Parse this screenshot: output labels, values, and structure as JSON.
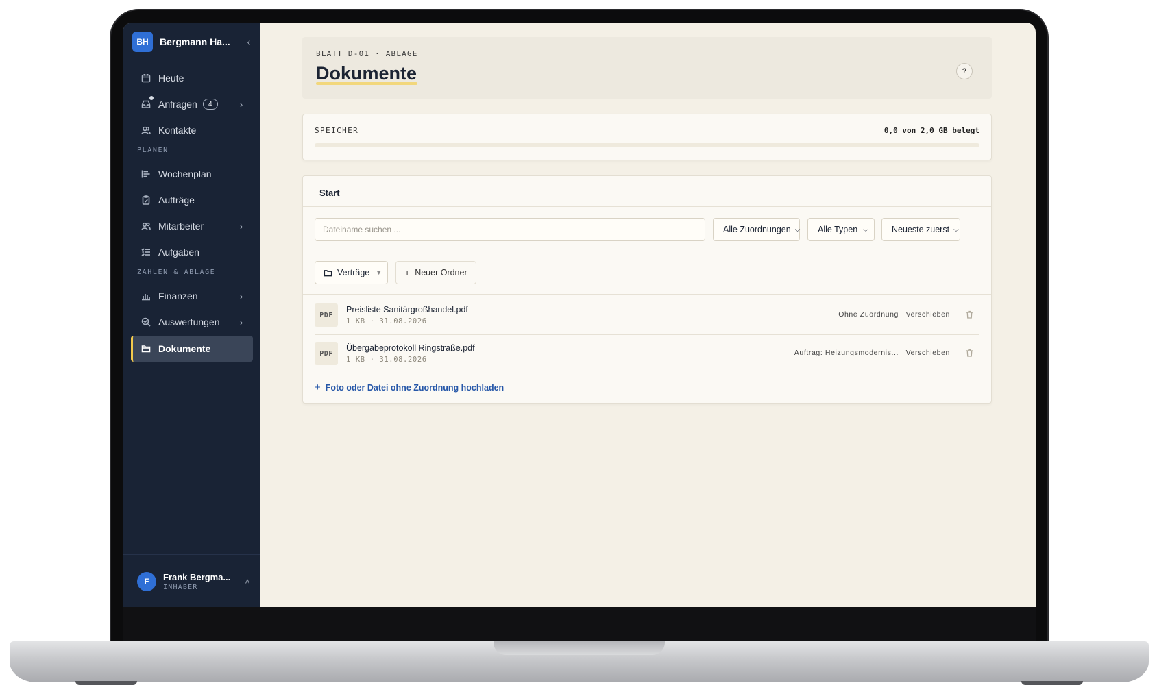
{
  "brand": {
    "initials": "BH",
    "name": "Bergmann Ha...",
    "collapse_icon": "chevron-left-icon"
  },
  "nav": {
    "items": [
      {
        "label": "Heute",
        "icon": "calendar-icon"
      },
      {
        "label": "Anfragen",
        "icon": "inbox-icon",
        "badge": "4",
        "has_dot": true,
        "expandable": true
      },
      {
        "label": "Kontakte",
        "icon": "contacts-icon"
      }
    ],
    "section_planen": "PLANEN",
    "planen_items": [
      {
        "label": "Wochenplan",
        "icon": "gantt-icon"
      },
      {
        "label": "Aufträge",
        "icon": "clipboard-check-icon"
      },
      {
        "label": "Mitarbeiter",
        "icon": "users-icon",
        "expandable": true
      },
      {
        "label": "Aufgaben",
        "icon": "checklist-icon"
      }
    ],
    "section_zahlen": "ZAHLEN & ABLAGE",
    "zahlen_items": [
      {
        "label": "Finanzen",
        "icon": "bar-chart-icon",
        "expandable": true
      },
      {
        "label": "Auswertungen",
        "icon": "zoom-chart-icon",
        "expandable": true
      },
      {
        "label": "Dokumente",
        "icon": "folder-icon",
        "active": true
      }
    ]
  },
  "user": {
    "initial": "F",
    "name": "Frank Bergma...",
    "role": "INHABER"
  },
  "header": {
    "sheet_label": "BLATT D-01 · ABLAGE",
    "title": "Dokumente",
    "help": "?"
  },
  "storage": {
    "title": "SPEICHER",
    "usage_text": "0,0 von 2,0 GB belegt",
    "used_fraction": 0.0
  },
  "files": {
    "breadcrumb": "Start",
    "search_placeholder": "Dateiname suchen ...",
    "filter_assignment": "Alle Zuordnungen",
    "filter_type": "Alle Typen",
    "sort": "Neueste zuerst",
    "folder_button": "Verträge",
    "new_folder_button": "Neuer Ordner",
    "rows": [
      {
        "badge": "PDF",
        "name": "Preisliste Sanitärgroßhandel.pdf",
        "meta": "1 KB · 31.08.2026",
        "assignment": "Ohne Zuordnung",
        "move": "Verschieben"
      },
      {
        "badge": "PDF",
        "name": "Übergabeprotokoll Ringstraße.pdf",
        "meta": "1 KB · 31.08.2026",
        "assignment": "Auftrag: Heizungsmodernis...",
        "move": "Verschieben"
      }
    ],
    "upload_link": "Foto oder Datei ohne Zuordnung hochladen"
  },
  "colors": {
    "sidebar_bg": "#192335",
    "accent": "#2f6fd6",
    "active_marker": "#f2c94c",
    "page_bg": "#f4f0e6"
  }
}
